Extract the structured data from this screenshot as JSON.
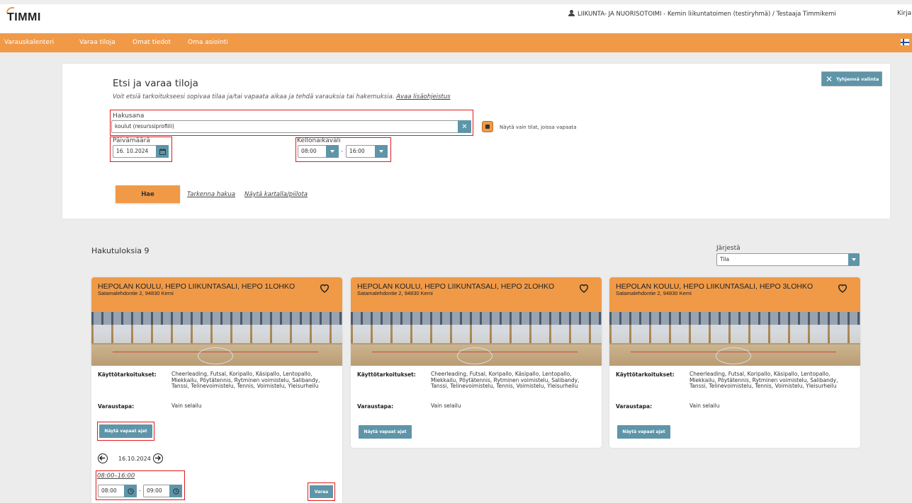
{
  "header": {
    "logo_text": "TIMMI",
    "user_info": "LIIKUNTA- JA NUORISOTOIMI - Kemin liikuntatoimen (testiryhmä) / Testaaja Timmikemi",
    "right_link": "Kirja"
  },
  "nav": {
    "items": [
      "Varauskalenteri",
      "Varaa tiloja",
      "Omat tiedot",
      "Oma asiointi"
    ]
  },
  "search": {
    "title": "Etsi ja varaa tiloja",
    "description": "Voit etsiä tarkoitukseesi sopivaa tilaa ja/tai vapaata aikaa ja tehdä varauksia tai hakemuksia.",
    "help_link": "Avaa lisäohjeistus",
    "clear_button": "Tyhjennä valinta",
    "keyword_label": "Hakusana",
    "keyword_value": "koulut (resurssiprofiili)",
    "only_free_label": "Näytä vain tilat, joissa vapaata",
    "date_label": "Päivämäärä",
    "date_value": "16. 10.2024",
    "time_label": "Kellonaikaväli",
    "time_start": "08:00",
    "time_end": "16:00",
    "time_separator": "-",
    "search_button": "Hae",
    "refine_link": "Tarkenna hakua",
    "map_link": "Näytä kartalla/piilota"
  },
  "results": {
    "count_label": "Hakutuloksia 9",
    "sort_label": "Järjestä",
    "sort_value": "Tila",
    "usage_label": "Käyttötarkoitukset:",
    "method_label": "Varaustapa:",
    "free_times_button": "Näytä vapaat ajat",
    "cards": [
      {
        "title": "HEPOLAN KOULU, HEPO LIIKUNTASALI, HEPO 1LOHKO",
        "address": "Satamalehdontie 2, 94830 Kemi",
        "usages": "Cheerleading, Futsal, Koripallo, Käsipallo, Lentopallo, Miekkailu, Pöytätennis, Rytminen voimistelu, Salibandy, Tanssi, Telinevoimistelu, Tennis, Voimistelu, Yleisurheilu",
        "method": "Vain selailu"
      },
      {
        "title": "HEPOLAN KOULU, HEPO LIIKUNTASALI, HEPO 2LOHKO",
        "address": "Satamalehdontie 2, 94830 Kemi",
        "usages": "Cheerleading, Futsal, Koripallo, Käsipallo, Lentopallo, Miekkailu, Pöytätennis, Rytminen voimistelu, Salibandy, Tanssi, Telinevoimistelu, Tennis, Voimistelu, Yleisurheilu",
        "method": "Vain selailu"
      },
      {
        "title": "HEPOLAN KOULU, HEPO LIIKUNTASALI, HEPO 3LOHKO",
        "address": "Satamalehdontie 2, 94830 Kemi",
        "usages": "Cheerleading, Futsal, Koripallo, Käsipallo, Lentopallo, Miekkailu, Pöytätennis, Rytminen voimistelu, Salibandy, Tanssi, Telinevoimistelu, Tennis, Voimistelu, Yleisurheilu",
        "method": "Vain selailu"
      }
    ],
    "expanded": {
      "date": "16.10.2024",
      "time_range_link": "08:00–16:00",
      "start_time": "08:00",
      "end_time": "09:00",
      "book_button": "Varaa"
    }
  },
  "colors": {
    "accent": "#f09a48",
    "button_blue": "#5e95a8",
    "highlight": "#e01b1b"
  }
}
